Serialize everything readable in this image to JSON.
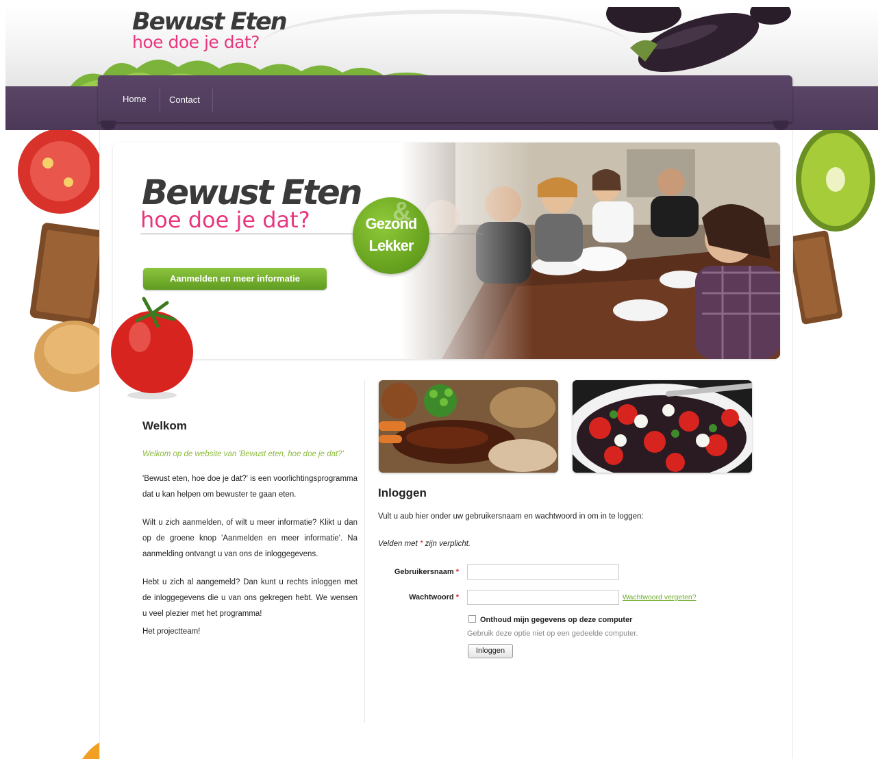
{
  "site": {
    "logo_title": "Bewust Eten",
    "logo_subtitle": "hoe doe je dat?"
  },
  "nav": {
    "items": [
      {
        "label": "Home"
      },
      {
        "label": "Contact"
      }
    ]
  },
  "hero": {
    "title": "Bewust Eten",
    "subtitle": "hoe doe je dat?",
    "badge_line1": "Gezond",
    "badge_amp": "&",
    "badge_line2": "Lekker",
    "cta_label": "Aanmelden en meer informatie"
  },
  "welcome": {
    "heading": "Welkom",
    "intro": "Welkom op de website van 'Bewust eten, hoe doe je dat?'",
    "paragraphs": [
      "'Bewust eten, hoe doe je dat?' is een voorlichtingsprogramma dat u kan helpen om bewuster te gaan eten.",
      "Wilt u zich aanmelden, of wilt u meer informatie? Klikt u dan op de groene knop 'Aanmelden en meer informatie'. Na aanmelding ontvangt u van ons de inloggegevens.",
      "Hebt u zich al aangemeld? Dan kunt u rechts inloggen met de inloggegevens die u van ons gekregen hebt. We wensen u veel plezier met het programma!"
    ],
    "signature": "Het projectteam!"
  },
  "login": {
    "heading": "Inloggen",
    "description": "Vult u aub hier onder uw gebruikersnaam en wachtwoord in om in te loggen:",
    "required_prefix": "Velden met",
    "required_star": "*",
    "required_suffix": "zijn verplicht.",
    "username_label": "Gebruikersnaam",
    "username_value": "",
    "password_label": "Wachtwoord",
    "password_value": "",
    "star": "*",
    "forgot_link": "Wachtwoord vergeten?",
    "remember_label": "Onthoud mijn gegevens op deze computer",
    "remember_checked": false,
    "hint": "Gebruik deze optie niet op een gedeelde computer.",
    "submit_label": "Inloggen"
  },
  "colors": {
    "nav_purple": "#4d3a59",
    "accent_pink": "#e8367f",
    "accent_green": "#6aa520",
    "required_red": "#d9262e"
  }
}
